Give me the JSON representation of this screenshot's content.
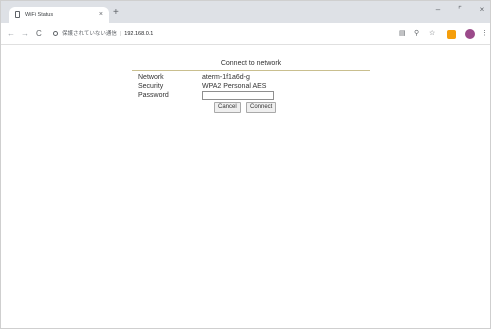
{
  "browser": {
    "tab": {
      "title": "WiFi Status",
      "close_glyph": "×"
    },
    "new_tab_glyph": "+",
    "window_controls": {
      "minimize": "–",
      "maximize": "⌜",
      "close": "×"
    },
    "nav": {
      "back": "←",
      "forward": "→",
      "reload": "C"
    },
    "omnibox": {
      "security_text": "保護されていない通信",
      "separator": "|",
      "url": "192.168.0.1"
    },
    "toolbar_icons": [
      "translate-icon",
      "zoom-icon",
      "bookmark-star-icon",
      "extension-icon",
      "profile-avatar-icon",
      "menu-icon"
    ],
    "toolbar_glyphs": {
      "translate": "▤",
      "zoom": "⚲",
      "star": "☆",
      "menu": "⋮"
    },
    "colors": {
      "tabstrip": "#dee1e6",
      "extension": "#f59e0b",
      "avatar": "#9b4a8a"
    }
  },
  "form": {
    "title": "Connect to network",
    "network_label": "Network",
    "network_value": "aterm-1f1a6d-g",
    "security_label": "Security",
    "security_value": "WPA2 Personal AES",
    "password_label": "Password",
    "password_value": "",
    "cancel_label": "Cancel",
    "connect_label": "Connect"
  }
}
